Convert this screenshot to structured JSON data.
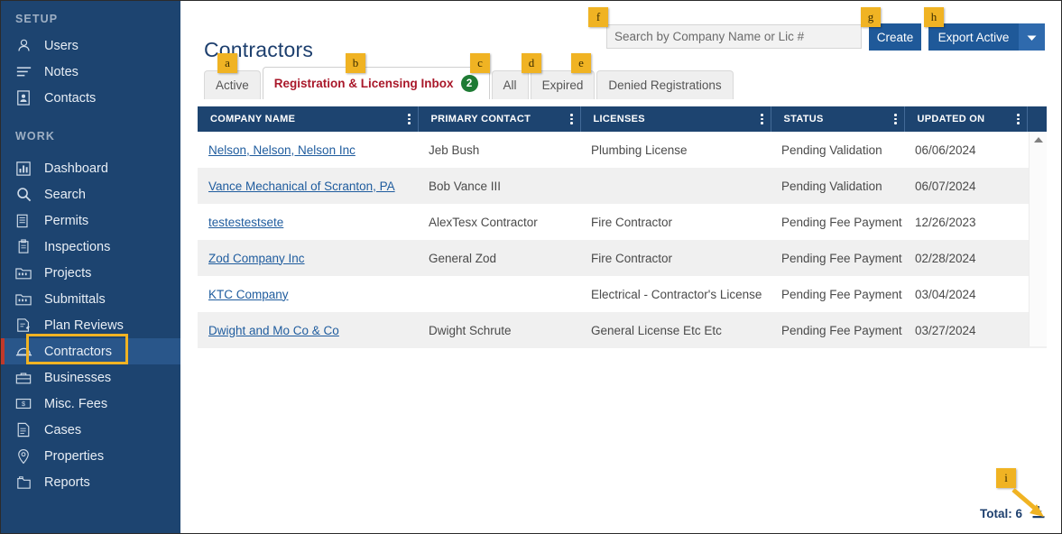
{
  "sidebar": {
    "sections": [
      {
        "label": "SETUP"
      },
      {
        "label": "WORK"
      }
    ],
    "setup_items": [
      {
        "label": "Users",
        "icon": "user-icon"
      },
      {
        "label": "Notes",
        "icon": "notes-icon"
      },
      {
        "label": "Contacts",
        "icon": "contacts-icon"
      }
    ],
    "work_items": [
      {
        "label": "Dashboard",
        "icon": "dashboard-icon"
      },
      {
        "label": "Search",
        "icon": "search-icon"
      },
      {
        "label": "Permits",
        "icon": "permits-icon"
      },
      {
        "label": "Inspections",
        "icon": "inspections-icon"
      },
      {
        "label": "Projects",
        "icon": "projects-icon"
      },
      {
        "label": "Submittals",
        "icon": "submittals-icon"
      },
      {
        "label": "Plan Reviews",
        "icon": "plan-reviews-icon"
      },
      {
        "label": "Contractors",
        "icon": "hardhat-icon"
      },
      {
        "label": "Businesses",
        "icon": "briefcase-icon"
      },
      {
        "label": "Misc. Fees",
        "icon": "money-icon"
      },
      {
        "label": "Cases",
        "icon": "case-icon"
      },
      {
        "label": "Properties",
        "icon": "location-pin-icon"
      },
      {
        "label": "Reports",
        "icon": "reports-icon"
      }
    ],
    "active_item": "Contractors"
  },
  "header": {
    "title": "Contractors"
  },
  "search": {
    "placeholder": "Search by Company Name or Lic #",
    "value": ""
  },
  "toolbar": {
    "create_label": "Create",
    "export_label": "Export Active",
    "export_caret_icon": "chevron-down-icon"
  },
  "tabs": [
    {
      "label": "Active",
      "active": false,
      "badge": ""
    },
    {
      "label": "Registration & Licensing Inbox",
      "active": true,
      "badge": "2"
    },
    {
      "label": "All",
      "active": false,
      "badge": ""
    },
    {
      "label": "Expired",
      "active": false,
      "badge": ""
    },
    {
      "label": "Denied Registrations",
      "active": false,
      "badge": ""
    }
  ],
  "table": {
    "columns": [
      {
        "label": "COMPANY NAME",
        "menu_icon": "kebab-menu-icon"
      },
      {
        "label": "PRIMARY CONTACT",
        "menu_icon": "kebab-menu-icon"
      },
      {
        "label": "LICENSES",
        "menu_icon": "kebab-menu-icon"
      },
      {
        "label": "STATUS",
        "menu_icon": "kebab-menu-icon"
      },
      {
        "label": "UPDATED ON",
        "menu_icon": "kebab-menu-icon"
      }
    ],
    "rows": [
      {
        "company": "Nelson, Nelson, Nelson Inc",
        "contact": "Jeb Bush",
        "licenses": "Plumbing License",
        "status": "Pending Validation",
        "updated": "06/06/2024"
      },
      {
        "company": "Vance Mechanical of Scranton, PA",
        "contact": "Bob Vance III",
        "licenses": "",
        "status": "Pending Validation",
        "updated": "06/07/2024"
      },
      {
        "company": "testestestsete",
        "contact": "AlexTesx Contractor",
        "licenses": "Fire Contractor",
        "status": "Pending Fee Payment",
        "updated": "12/26/2023"
      },
      {
        "company": "Zod Company Inc",
        "contact": "General Zod",
        "licenses": "Fire Contractor",
        "status": "Pending Fee Payment",
        "updated": "02/28/2024"
      },
      {
        "company": "KTC Company",
        "contact": "",
        "licenses": "Electrical - Contractor's License",
        "status": "Pending Fee Payment",
        "updated": "03/04/2024"
      },
      {
        "company": "Dwight and Mo Co & Co",
        "contact": "Dwight Schrute",
        "licenses": "General License Etc Etc",
        "status": "Pending Fee Payment",
        "updated": "03/27/2024"
      }
    ]
  },
  "footer": {
    "total_label": "Total: 6",
    "download_icon": "download-icon"
  },
  "annotations": [
    {
      "id": "a",
      "target": "tab-active"
    },
    {
      "id": "b",
      "target": "tab-registration-licensing-inbox"
    },
    {
      "id": "c",
      "target": "tab-all"
    },
    {
      "id": "d",
      "target": "tab-expired"
    },
    {
      "id": "e",
      "target": "tab-denied-registrations"
    },
    {
      "id": "f",
      "target": "search-input"
    },
    {
      "id": "g",
      "target": "create-button"
    },
    {
      "id": "h",
      "target": "export-active-button"
    },
    {
      "id": "i",
      "target": "download-icon"
    },
    {
      "id": "contractors-highlight",
      "target": "sidebar-item-contractors"
    }
  ],
  "colors": {
    "sidebar_bg": "#1d4470",
    "accent_blue": "#1f5999",
    "annotation_gold": "#f0b323",
    "active_tab_red": "#a9182a",
    "badge_green": "#1e7b34",
    "link_blue": "#1f5c9e",
    "active_nav_red_bar": "#c0392b"
  }
}
